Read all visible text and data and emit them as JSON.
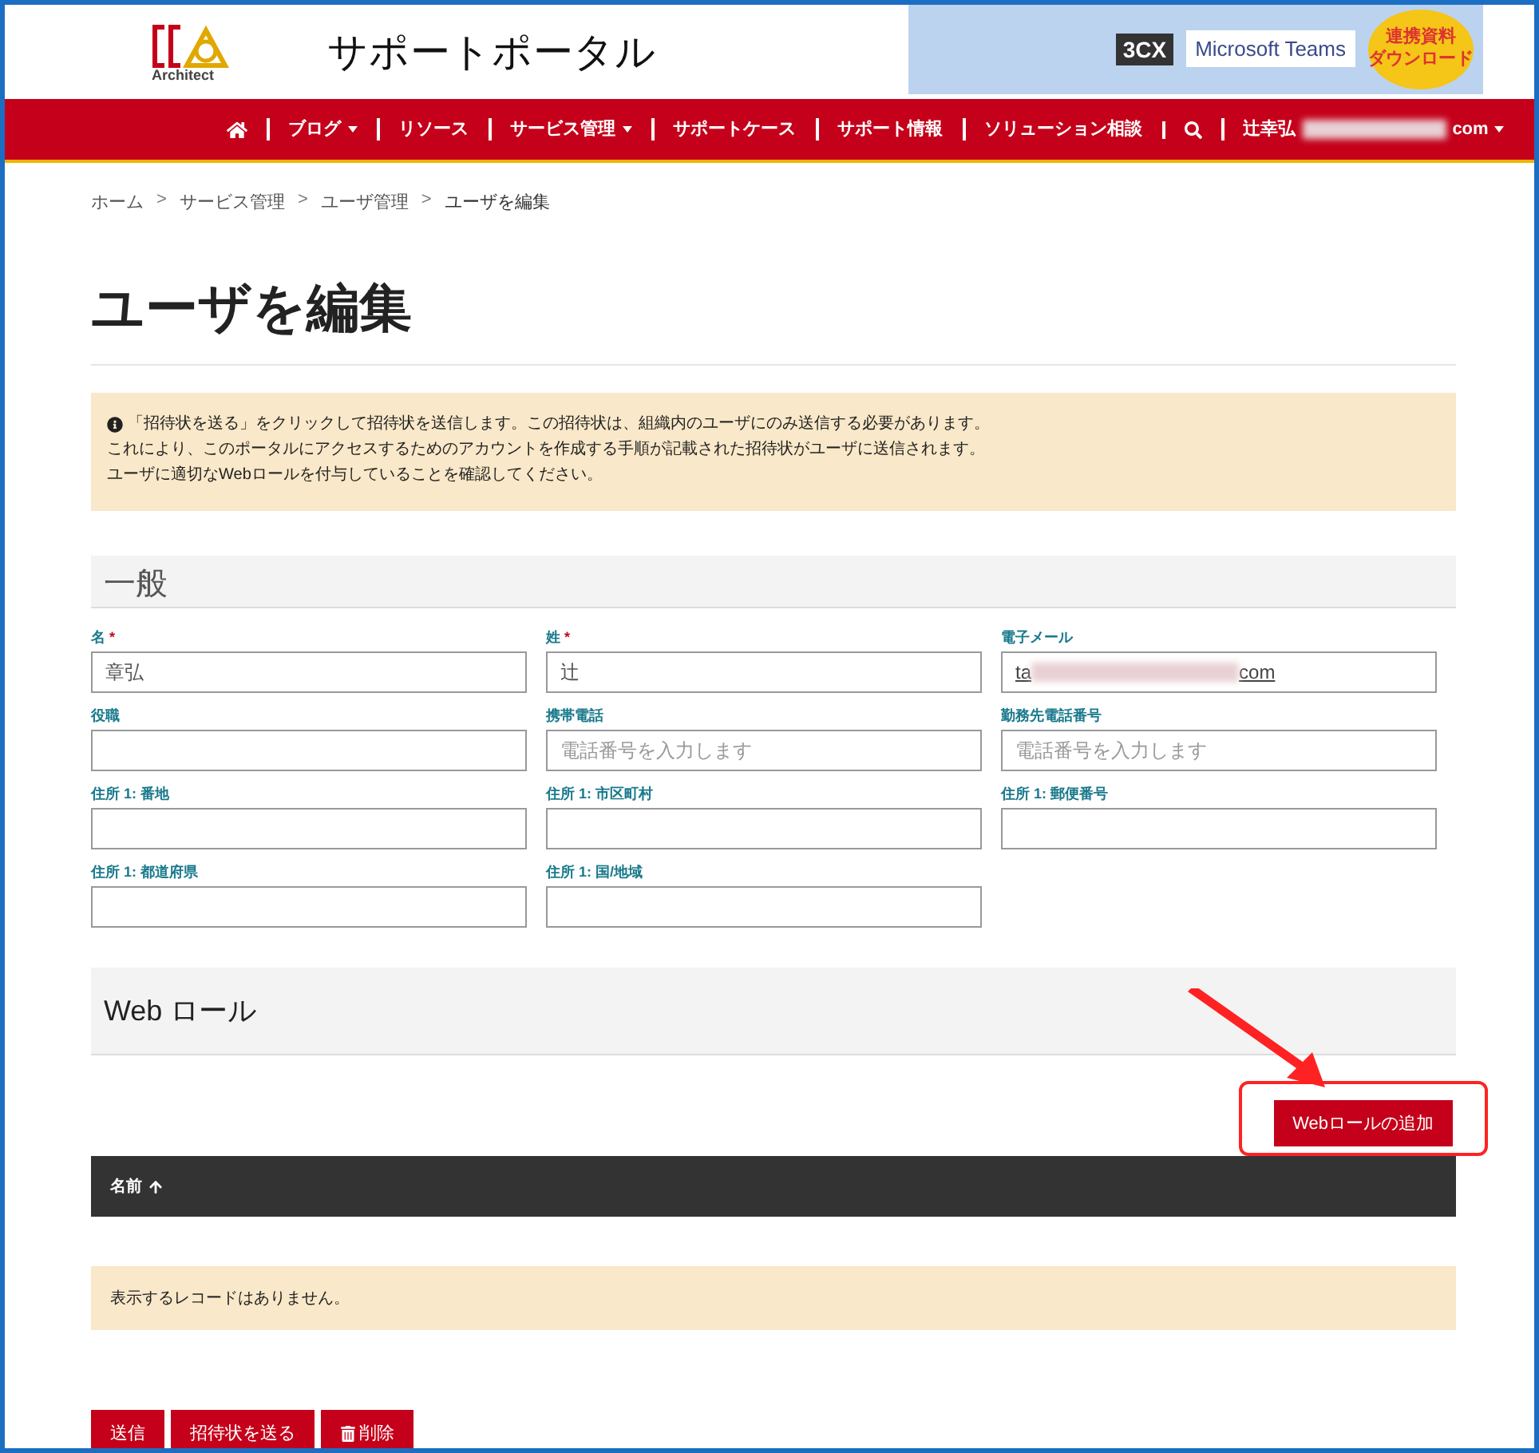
{
  "header": {
    "logo_text": "Architect",
    "site_title": "サポートポータル",
    "banner": {
      "brand": "3CX",
      "product": "Microsoft Teams",
      "badge_line_1": "連携資料",
      "badge_line_2": "ダウンロード"
    }
  },
  "nav": [
    {
      "kind": "home",
      "dropdown": false
    },
    {
      "kind": "link",
      "label": "ブログ",
      "dropdown": true
    },
    {
      "kind": "link",
      "label": "リソース",
      "dropdown": false
    },
    {
      "kind": "link",
      "label": "サービス管理",
      "dropdown": true
    },
    {
      "kind": "link",
      "label": "サポートケース",
      "dropdown": false
    },
    {
      "kind": "link",
      "label": "サポート情報",
      "dropdown": false
    },
    {
      "kind": "link",
      "label": "ソリューション相談",
      "dropdown": false
    },
    {
      "kind": "search",
      "dropdown": false
    },
    {
      "kind": "user",
      "label": "辻幸弘",
      "suffix": "com",
      "dropdown": true
    }
  ],
  "breadcrumb": {
    "separator": ">",
    "items": [
      {
        "label": "ホーム",
        "current": false
      },
      {
        "label": "サービス管理",
        "current": false
      },
      {
        "label": "ユーザ管理",
        "current": false
      },
      {
        "label": "ユーザを編集",
        "current": true
      }
    ]
  },
  "page_title": "ユーザを編集",
  "notice": {
    "lines": [
      "「招待状を送る」をクリックして招待状を送信します。この招待状は、組織内のユーザにのみ送信する必要があります。",
      "これにより、このポータルにアクセスするためのアカウントを作成する手順が記載された招待状がユーザに送信されます。",
      "ユーザに適切なWebロールを付与していることを確認してください。"
    ]
  },
  "general": {
    "title": "一般",
    "fields": [
      {
        "kind": "input",
        "label": "名",
        "required_mark": "*",
        "value": "章弘"
      },
      {
        "kind": "input",
        "label": "姓",
        "required_mark": "*",
        "value": "辻"
      },
      {
        "kind": "redacted-link",
        "label": "電子メール",
        "value_start": "ta",
        "value_end": "com"
      },
      {
        "kind": "input",
        "label": "役職"
      },
      {
        "kind": "input",
        "label": "携帯電話",
        "placeholder": "電話番号を入力します"
      },
      {
        "kind": "input",
        "label": "勤務先電話番号",
        "placeholder": "電話番号を入力します"
      },
      {
        "kind": "input",
        "label": "住所 1: 番地"
      },
      {
        "kind": "input",
        "label": "住所 1: 市区町村"
      },
      {
        "kind": "input",
        "label": "住所 1: 郵便番号"
      },
      {
        "kind": "input",
        "label": "住所 1: 都道府県"
      },
      {
        "kind": "input",
        "label": "住所 1: 国/地域"
      }
    ]
  },
  "web_roles": {
    "title": "Web ロール",
    "add_button": "Webロールの追加",
    "columns": [
      {
        "label": "名前",
        "sorted_ascending": true
      }
    ],
    "empty_message": "表示するレコードはありません。"
  },
  "actions": [
    {
      "kind": "text",
      "label": "送信"
    },
    {
      "kind": "text",
      "label": "招待状を送る"
    },
    {
      "kind": "delete",
      "label": "削除"
    }
  ]
}
